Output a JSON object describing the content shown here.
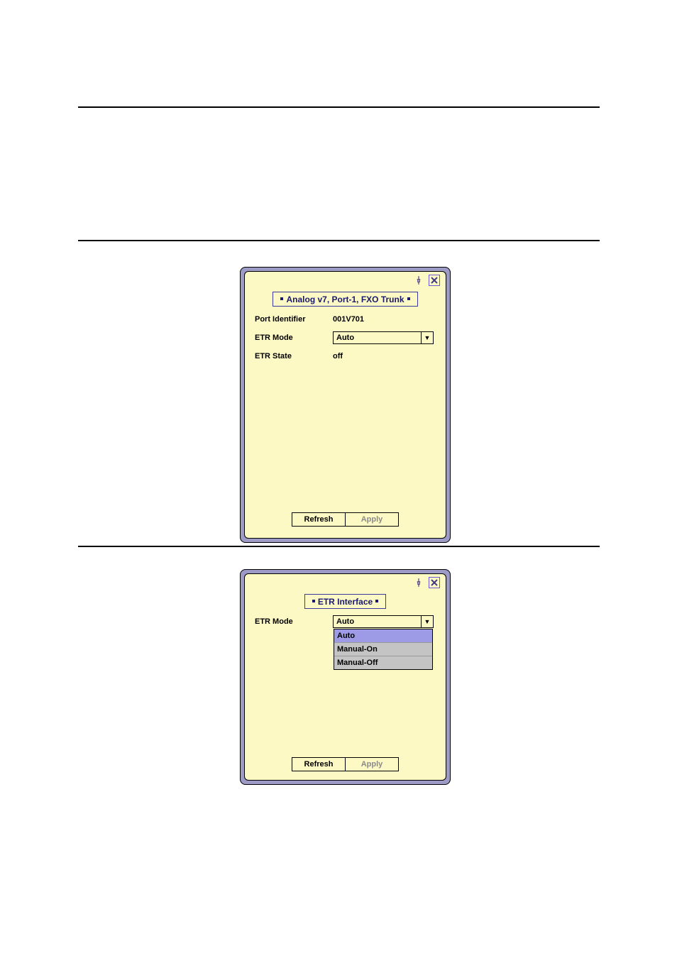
{
  "panel1": {
    "title": "Analog v7, Port-1, FXO Trunk",
    "fields": {
      "port_identifier_label": "Port Identifier",
      "port_identifier_value": "001V701",
      "etr_mode_label": "ETR Mode",
      "etr_mode_value": "Auto",
      "etr_state_label": "ETR State",
      "etr_state_value": "off"
    },
    "buttons": {
      "refresh": "Refresh",
      "apply": "Apply"
    }
  },
  "panel2": {
    "title": "ETR Interface",
    "fields": {
      "etr_mode_label": "ETR Mode",
      "etr_mode_value": "Auto"
    },
    "dropdown_options": {
      "opt0": "Auto",
      "opt1": "Manual-On",
      "opt2": "Manual-Off"
    },
    "buttons": {
      "refresh": "Refresh",
      "apply": "Apply"
    }
  },
  "icons": {
    "pushpin": "pushpin-icon",
    "close": "close-icon"
  }
}
